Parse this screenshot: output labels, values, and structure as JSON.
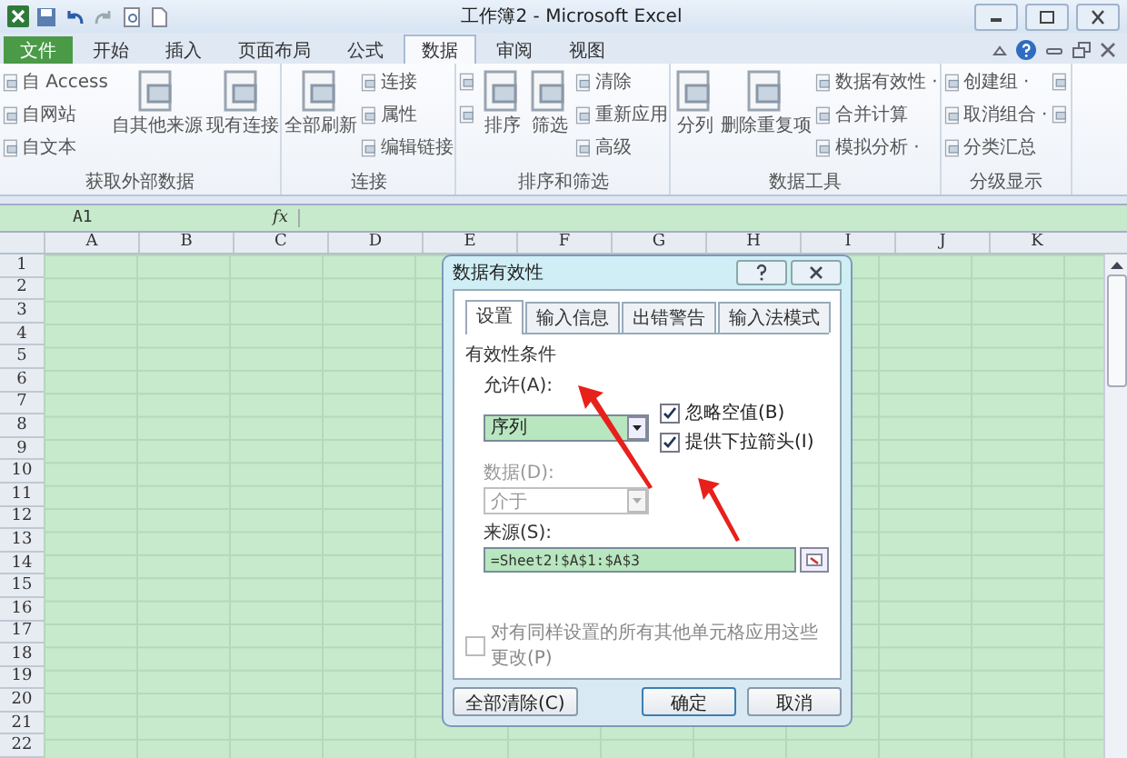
{
  "title_bar": {
    "title": "工作簿2 - Microsoft Excel"
  },
  "ribbon_tabs": [
    {
      "label": "文件",
      "kind": "file",
      "selected": false
    },
    {
      "label": "开始",
      "kind": "tab",
      "selected": false
    },
    {
      "label": "插入",
      "kind": "tab",
      "selected": false
    },
    {
      "label": "页面布局",
      "kind": "tab",
      "selected": false
    },
    {
      "label": "公式",
      "kind": "tab",
      "selected": false
    },
    {
      "label": "数据",
      "kind": "tab",
      "selected": true
    },
    {
      "label": "审阅",
      "kind": "tab",
      "selected": false
    },
    {
      "label": "视图",
      "kind": "tab",
      "selected": false
    }
  ],
  "ribbon_groups": [
    {
      "label": "获取外部数据",
      "items": [
        {
          "kind": "small",
          "label": "自 Access"
        },
        {
          "kind": "small",
          "label": "自网站"
        },
        {
          "kind": "small",
          "label": "自文本"
        },
        {
          "kind": "large",
          "label": "自其他来源"
        },
        {
          "kind": "large",
          "label": "现有连接"
        }
      ]
    },
    {
      "label": "连接",
      "items": [
        {
          "kind": "large",
          "label": "全部刷新"
        },
        {
          "kind": "small",
          "label": "连接"
        },
        {
          "kind": "small",
          "label": "属性"
        },
        {
          "kind": "small",
          "label": "编辑链接"
        }
      ]
    },
    {
      "label": "排序和筛选",
      "items": [
        {
          "kind": "icon"
        },
        {
          "kind": "icon"
        },
        {
          "kind": "large",
          "label": "排序"
        },
        {
          "kind": "large",
          "label": "筛选"
        },
        {
          "kind": "small",
          "label": "清除"
        },
        {
          "kind": "small",
          "label": "重新应用"
        },
        {
          "kind": "small",
          "label": "高级"
        }
      ]
    },
    {
      "label": "数据工具",
      "items": [
        {
          "kind": "large",
          "label": "分列"
        },
        {
          "kind": "large",
          "label": "删除重复项"
        },
        {
          "kind": "small",
          "label": "数据有效性 ·"
        },
        {
          "kind": "small",
          "label": "合并计算"
        },
        {
          "kind": "small",
          "label": "模拟分析 ·"
        }
      ]
    },
    {
      "label": "分级显示",
      "items": [
        {
          "kind": "small",
          "label": "创建组 ·"
        },
        {
          "kind": "small",
          "label": "取消组合 ·"
        },
        {
          "kind": "small",
          "label": "分类汇总"
        },
        {
          "kind": "icon"
        },
        {
          "kind": "icon"
        }
      ]
    }
  ],
  "formula_bar": {
    "name_box": "A1",
    "function_label": "fx"
  },
  "columns": [
    "A",
    "B",
    "C",
    "D",
    "E",
    "F",
    "G",
    "H",
    "I",
    "J",
    "K"
  ],
  "rows": [
    "1",
    "2",
    "3",
    "4",
    "5",
    "6",
    "7",
    "8",
    "9",
    "10",
    "11",
    "12",
    "13",
    "14",
    "15",
    "16",
    "17",
    "18",
    "19",
    "20",
    "21",
    "22"
  ],
  "dialog": {
    "title": "数据有效性",
    "tabs": [
      {
        "label": "设置",
        "selected": true
      },
      {
        "label": "输入信息",
        "selected": false
      },
      {
        "label": "出错警告",
        "selected": false
      },
      {
        "label": "输入法模式",
        "selected": false
      }
    ],
    "section": "有效性条件",
    "allow": {
      "label": "允许(A):",
      "value": "序列",
      "focused": true
    },
    "checkboxes": [
      {
        "label": "忽略空值(B)",
        "checked": true
      },
      {
        "label": "提供下拉箭头(I)",
        "checked": true
      }
    ],
    "data": {
      "label": "数据(D):",
      "value": "介于",
      "disabled": true
    },
    "source": {
      "label": "来源(S):",
      "value": "=Sheet2!$A$1:$A$3"
    },
    "apply_all": {
      "label": "对有同样设置的所有其他单元格应用这些更改(P)",
      "checked": false,
      "disabled": true
    },
    "buttons": [
      {
        "label": "全部清除(C)",
        "kind": "clear"
      },
      {
        "label": "确定",
        "kind": "default"
      },
      {
        "label": "取消",
        "kind": "normal"
      }
    ]
  }
}
